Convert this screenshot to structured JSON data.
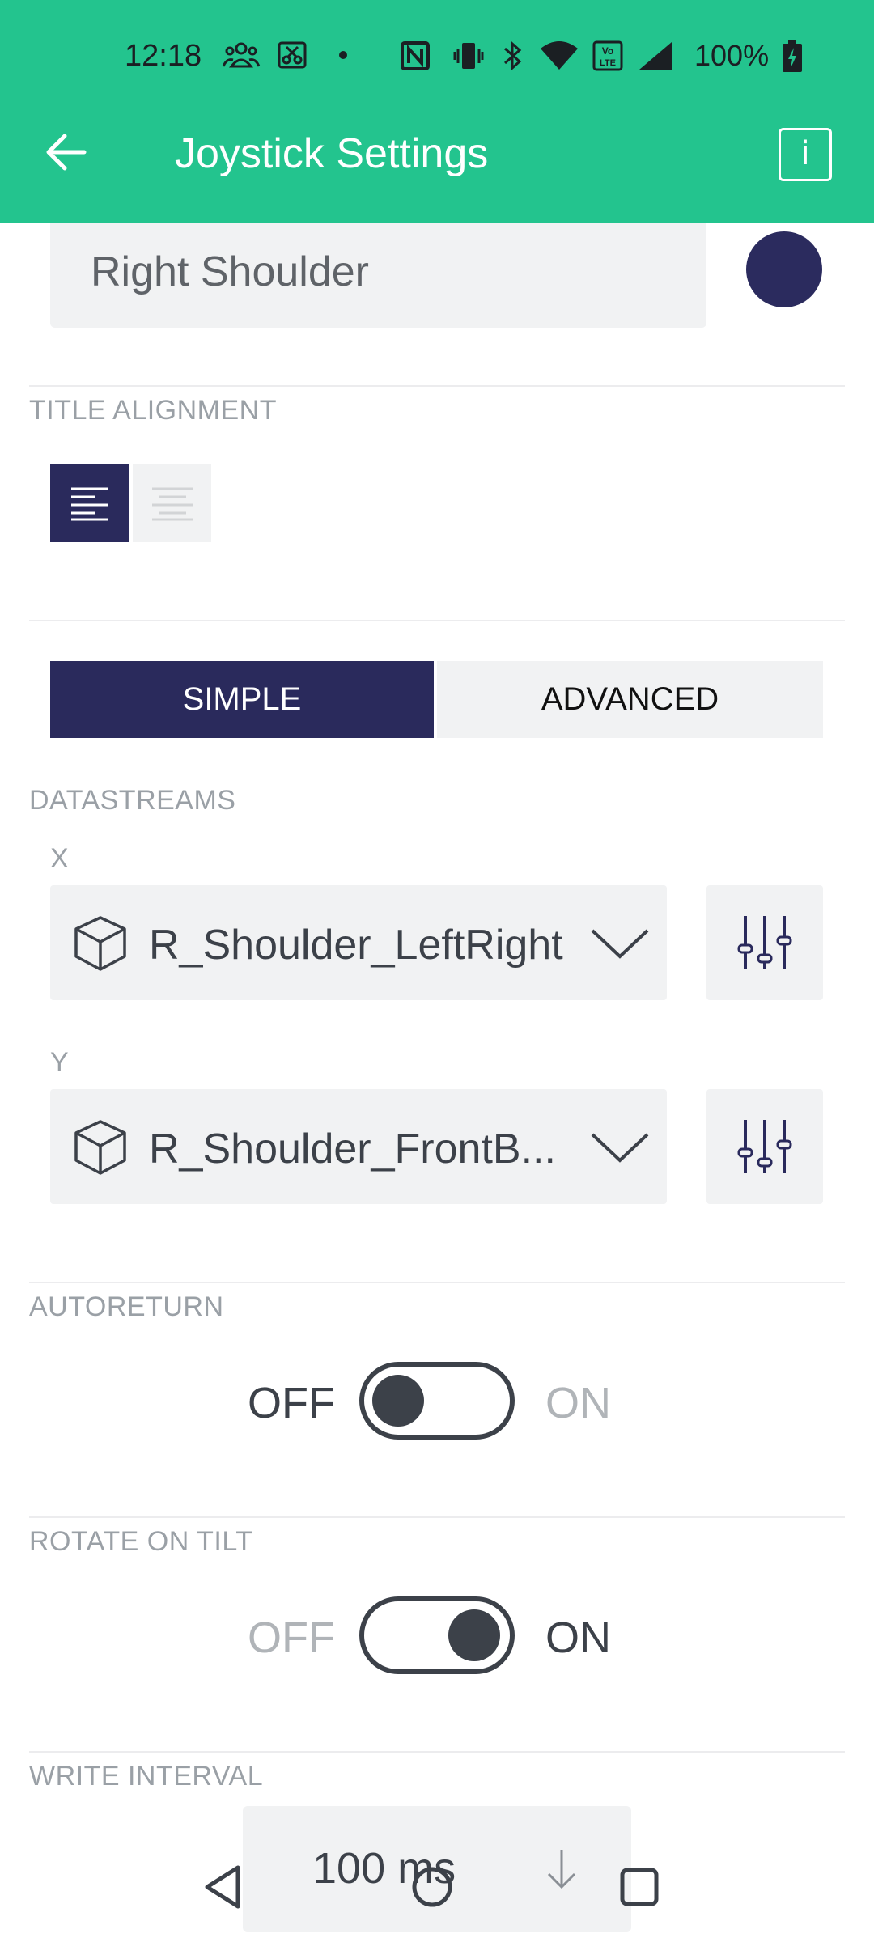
{
  "status_bar": {
    "time": "12:18",
    "battery": "100%"
  },
  "toolbar": {
    "title": "Joystick Settings",
    "info_label": "i"
  },
  "widget": {
    "name": "Right Shoulder",
    "color": "#2b2b5e"
  },
  "title_alignment": {
    "label": "TITLE ALIGNMENT",
    "selected": "left"
  },
  "mode": {
    "simple_label": "SIMPLE",
    "advanced_label": "ADVANCED",
    "selected": "SIMPLE"
  },
  "datastreams": {
    "label": "DATASTREAMS",
    "x": {
      "label": "X",
      "value": "R_Shoulder_LeftRight"
    },
    "y": {
      "label": "Y",
      "value": "R_Shoulder_FrontB..."
    }
  },
  "autoreturn": {
    "label": "AUTORETURN",
    "off_label": "OFF",
    "on_label": "ON",
    "state": "off"
  },
  "rotate_on_tilt": {
    "label": "ROTATE ON TILT",
    "off_label": "OFF",
    "on_label": "ON",
    "state": "on"
  },
  "write_interval": {
    "label": "WRITE INTERVAL",
    "value": "100 ms"
  },
  "colors": {
    "accent": "#23c48e",
    "selected": "#2a2a5c",
    "field_bg": "#f1f2f3"
  }
}
